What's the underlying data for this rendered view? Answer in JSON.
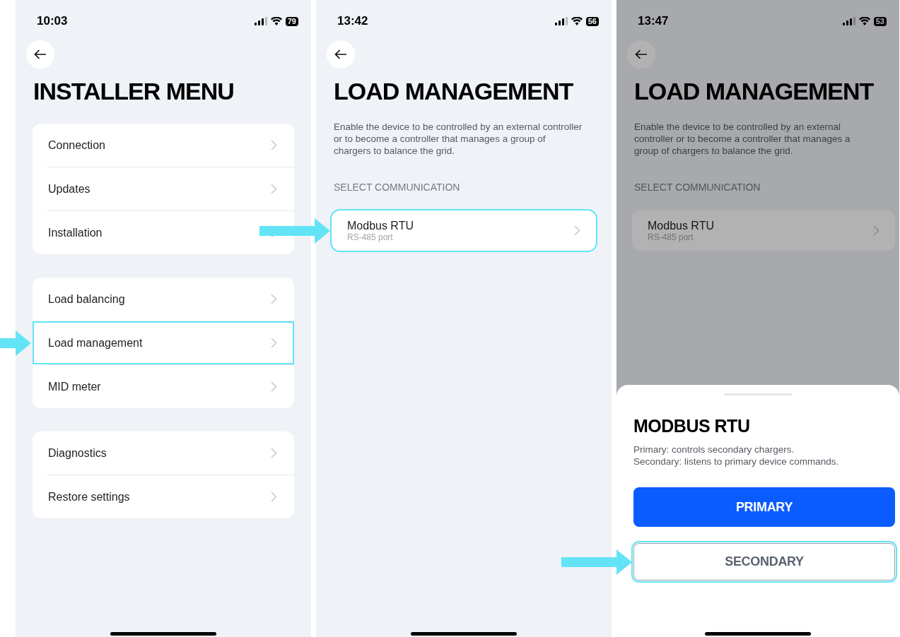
{
  "screens": [
    {
      "kind": "menu",
      "status_bar": {
        "time": "10:03",
        "battery": "79"
      },
      "title": "INSTALLER MENU",
      "dimmed": false,
      "groups": [
        {
          "items": [
            {
              "label": "Connection",
              "highlighted": false
            },
            {
              "label": "Updates",
              "highlighted": false
            },
            {
              "label": "Installation",
              "highlighted": false
            }
          ]
        },
        {
          "items": [
            {
              "label": "Load balancing",
              "highlighted": false
            },
            {
              "label": "Load management",
              "highlighted": true
            },
            {
              "label": "MID meter",
              "highlighted": false
            }
          ]
        },
        {
          "items": [
            {
              "label": "Diagnostics",
              "highlighted": false
            },
            {
              "label": "Restore settings",
              "highlighted": false
            }
          ]
        }
      ]
    },
    {
      "kind": "detail",
      "status_bar": {
        "time": "13:42",
        "battery": "56"
      },
      "title": "LOAD MANAGEMENT",
      "dimmed": false,
      "description": "Enable the device to be controlled by an external controller or to become a controller that manages a group of chargers to balance the grid.",
      "section_label": "SELECT COMMUNICATION",
      "options": [
        {
          "title": "Modbus RTU",
          "subtitle": "RS-485 port",
          "highlighted": true
        }
      ]
    },
    {
      "kind": "detail",
      "status_bar": {
        "time": "13:47",
        "battery": "53"
      },
      "title": "LOAD MANAGEMENT",
      "dimmed": true,
      "description": "Enable the device to be controlled by an external controller or to become a controller that manages a group of chargers to balance the grid.",
      "section_label": "SELECT COMMUNICATION",
      "options": [
        {
          "title": "Modbus RTU",
          "subtitle": "RS-485 port",
          "highlighted": false
        }
      ],
      "sheet": {
        "title": "MODBUS RTU",
        "description_lines": [
          "Primary: controls secondary chargers.",
          "Secondary: listens to primary device commands."
        ],
        "buttons": [
          {
            "label": "PRIMARY",
            "kind": "primary",
            "highlighted": false
          },
          {
            "label": "SECONDARY",
            "kind": "secondary",
            "highlighted": true
          }
        ]
      }
    }
  ]
}
